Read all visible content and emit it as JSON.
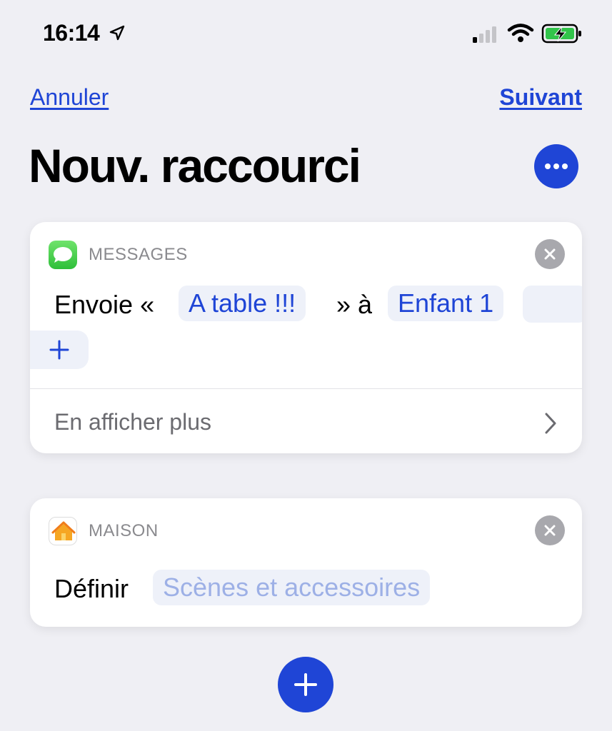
{
  "status_bar": {
    "time": "16:14",
    "icons": [
      "location-arrow-icon",
      "signal-icon",
      "wifi-icon",
      "battery-charging-icon"
    ]
  },
  "nav": {
    "cancel_label": "Annuler",
    "next_label": "Suivant"
  },
  "title": "Nouv. raccourci",
  "more_icon": "ellipsis-icon",
  "actions": [
    {
      "app_name": "MESSAGES",
      "app_icon": "messages-icon",
      "prefix": "Envoie «",
      "message_token": "A table !!!",
      "middle": "» à",
      "recipient_token": "Enfant 1",
      "show_more": "En afficher plus"
    },
    {
      "app_name": "MAISON",
      "app_icon": "home-icon",
      "prefix": "Définir",
      "placeholder_token": "Scènes et accessoires"
    }
  ],
  "colors": {
    "accent": "#1f45d6",
    "background": "#efeff4",
    "token_bg": "#eef1f9"
  }
}
